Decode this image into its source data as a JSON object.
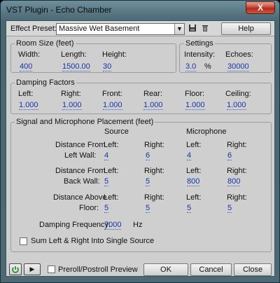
{
  "window": {
    "title": "VST Plugin - Echo Chamber",
    "close_glyph": "X"
  },
  "preset": {
    "label": "Effect Preset:",
    "value": "Massive Wet Basement",
    "save_icon": "save-icon",
    "delete_icon": "trash-icon",
    "help_label": "Help"
  },
  "room_size": {
    "title": "Room Size (feet)",
    "width_label": "Width:",
    "width_value": "400",
    "length_label": "Length:",
    "length_value": "1500.00",
    "height_label": "Height:",
    "height_value": "30"
  },
  "settings": {
    "title": "Settings",
    "intensity_label": "Intensity:",
    "intensity_value": "3.0",
    "intensity_unit": "%",
    "echoes_label": "Echoes:",
    "echoes_value": "30000"
  },
  "damping": {
    "title": "Damping Factors",
    "left_label": "Left:",
    "left_value": "1.000",
    "right_label": "Right:",
    "right_value": "1.000",
    "front_label": "Front:",
    "front_value": "1.000",
    "rear_label": "Rear:",
    "rear_value": "1.000",
    "floor_label": "Floor:",
    "floor_value": "1.000",
    "ceiling_label": "Ceiling:",
    "ceiling_value": "1.000"
  },
  "placement": {
    "title": "Signal and Microphone Placement (feet)",
    "source_header": "Source",
    "mic_header": "Microphone",
    "left_label": "Left:",
    "right_label": "Right:",
    "row1_label_a": "Distance From",
    "row1_label_b": "Left Wall:",
    "row1_values": [
      "4",
      "6",
      "4",
      "6"
    ],
    "row2_label_a": "Distance From",
    "row2_label_b": "Back Wall:",
    "row2_values": [
      "5",
      "5",
      "800",
      "800"
    ],
    "row3_label_a": "Distance Above",
    "row3_label_b": "Floor:",
    "row3_values": [
      "5",
      "5",
      "5",
      "5"
    ],
    "damping_freq_label": "Damping Frequency:",
    "damping_freq_value": "7000",
    "damping_freq_unit": "Hz",
    "sum_label": "Sum Left & Right Into Single Source",
    "sum_checked": false
  },
  "footer": {
    "power_icon": "power-icon",
    "play_icon": "play-icon",
    "preroll_label": "Preroll/Postroll Preview",
    "ok_label": "OK",
    "cancel_label": "Cancel",
    "close_label": "Close"
  }
}
